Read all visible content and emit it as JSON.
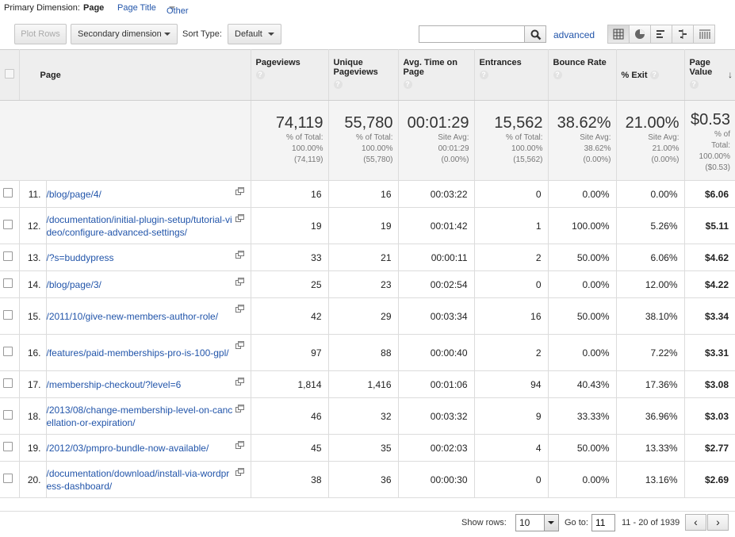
{
  "dimension_bar": {
    "label": "Primary Dimension:",
    "options": [
      "Page",
      "Page Title",
      "Other"
    ],
    "selected": "Page"
  },
  "toolbar": {
    "plot_rows": "Plot Rows",
    "secondary_dimension": "Secondary dimension",
    "sort_type_label": "Sort Type:",
    "sort_type_value": "Default",
    "search_value": "",
    "advanced_link": "advanced",
    "view_icons": [
      "data-table-icon",
      "pie-chart-icon",
      "performance-icon",
      "comparison-icon",
      "pivot-icon"
    ]
  },
  "columns": {
    "page": "Page",
    "pageviews": "Pageviews",
    "unique_pageviews": "Unique Pageviews",
    "avg_time": "Avg. Time on Page",
    "entrances": "Entrances",
    "bounce_rate": "Bounce Rate",
    "exit": "% Exit",
    "page_value": "Page Value",
    "help": "?"
  },
  "summary": {
    "pageviews": {
      "big": "74,119",
      "l1": "% of Total:",
      "l2": "100.00%",
      "l3": "(74,119)"
    },
    "unique_pageviews": {
      "big": "55,780",
      "l1": "% of Total:",
      "l2": "100.00%",
      "l3": "(55,780)"
    },
    "avg_time": {
      "big": "00:01:29",
      "l1": "Site Avg:",
      "l2": "00:01:29",
      "l3": "(0.00%)"
    },
    "entrances": {
      "big": "15,562",
      "l1": "% of Total:",
      "l2": "100.00%",
      "l3": "(15,562)"
    },
    "bounce_rate": {
      "big": "38.62%",
      "l1": "Site Avg:",
      "l2": "38.62%",
      "l3": "(0.00%)"
    },
    "exit": {
      "big": "21.00%",
      "l1": "Site Avg:",
      "l2": "21.00%",
      "l3": "(0.00%)"
    },
    "page_value": {
      "big": "$0.53",
      "l1": "% of",
      "l2": "Total:",
      "l3": "100.00%",
      "l4": "($0.53)"
    }
  },
  "rows": [
    {
      "idx": "11.",
      "page": "/blog/page/4/",
      "pageviews": "16",
      "unique": "16",
      "avg_time": "00:03:22",
      "entrances": "0",
      "bounce": "0.00%",
      "exit": "0.00%",
      "value": "$6.06"
    },
    {
      "idx": "12.",
      "page": "/documentation/initial-plugin-setup/tutorial-video/configure-advanced-settings/",
      "pageviews": "19",
      "unique": "19",
      "avg_time": "00:01:42",
      "entrances": "1",
      "bounce": "100.00%",
      "exit": "5.26%",
      "value": "$5.11"
    },
    {
      "idx": "13.",
      "page": "/?s=buddypress",
      "pageviews": "33",
      "unique": "21",
      "avg_time": "00:00:11",
      "entrances": "2",
      "bounce": "50.00%",
      "exit": "6.06%",
      "value": "$4.62"
    },
    {
      "idx": "14.",
      "page": "/blog/page/3/",
      "pageviews": "25",
      "unique": "23",
      "avg_time": "00:02:54",
      "entrances": "0",
      "bounce": "0.00%",
      "exit": "12.00%",
      "value": "$4.22"
    },
    {
      "idx": "15.",
      "page": "/2011/10/give-new-members-author-role/",
      "pageviews": "42",
      "unique": "29",
      "avg_time": "00:03:34",
      "entrances": "16",
      "bounce": "50.00%",
      "exit": "38.10%",
      "value": "$3.34"
    },
    {
      "idx": "16.",
      "page": "/features/paid-memberships-pro-is-100-gpl/",
      "pageviews": "97",
      "unique": "88",
      "avg_time": "00:00:40",
      "entrances": "2",
      "bounce": "0.00%",
      "exit": "7.22%",
      "value": "$3.31"
    },
    {
      "idx": "17.",
      "page": "/membership-checkout/?level=6",
      "pageviews": "1,814",
      "unique": "1,416",
      "avg_time": "00:01:06",
      "entrances": "94",
      "bounce": "40.43%",
      "exit": "17.36%",
      "value": "$3.08"
    },
    {
      "idx": "18.",
      "page": "/2013/08/change-membership-level-on-cancellation-or-expiration/",
      "pageviews": "46",
      "unique": "32",
      "avg_time": "00:03:32",
      "entrances": "9",
      "bounce": "33.33%",
      "exit": "36.96%",
      "value": "$3.03"
    },
    {
      "idx": "19.",
      "page": "/2012/03/pmpro-bundle-now-available/",
      "pageviews": "45",
      "unique": "35",
      "avg_time": "00:02:03",
      "entrances": "4",
      "bounce": "50.00%",
      "exit": "13.33%",
      "value": "$2.77"
    },
    {
      "idx": "20.",
      "page": "/documentation/download/install-via-wordpress-dashboard/",
      "pageviews": "38",
      "unique": "36",
      "avg_time": "00:00:30",
      "entrances": "0",
      "bounce": "0.00%",
      "exit": "13.16%",
      "value": "$2.69"
    }
  ],
  "pagination": {
    "show_rows_label": "Show rows:",
    "show_rows_value": "10",
    "goto_label": "Go to:",
    "goto_value": "11",
    "range_text": "11 - 20 of 1939",
    "prev": "‹",
    "next": "›"
  },
  "colors": {
    "link": "#2255aa",
    "header_bg": "#eeeeee",
    "summary_bg": "#f4f4f4"
  }
}
